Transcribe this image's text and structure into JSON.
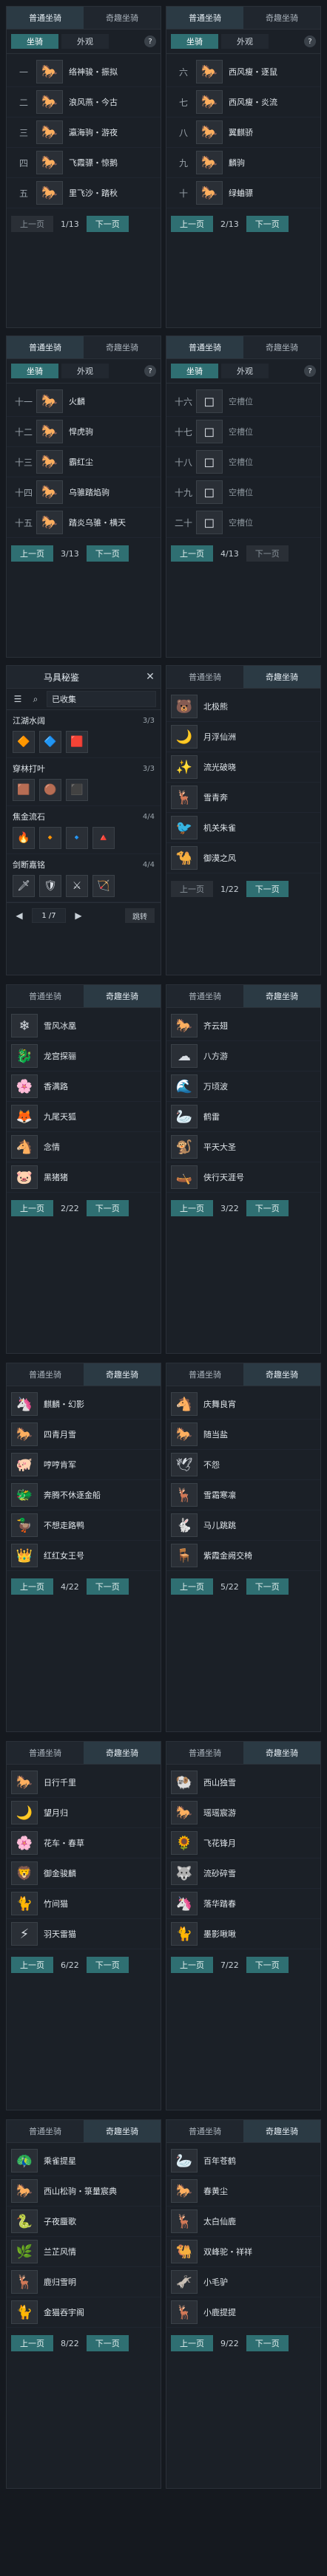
{
  "labels": {
    "cat_normal": "普通坐骑",
    "cat_rare": "奇趣坐骑",
    "sub_mount": "坐骑",
    "sub_look": "外观",
    "help": "?",
    "prev": "上一页",
    "next": "下一页"
  },
  "icons": {
    "mount": "horse-icon",
    "empty": "empty-slot-icon",
    "close": "close-icon",
    "filter": "filter-icon",
    "search": "search-icon",
    "arrow_left": "arrow-left-icon",
    "arrow_right": "arrow-right-icon"
  },
  "left_panels": [
    {
      "page": "1/13",
      "rows": [
        {
          "idx": "一",
          "name": "络神骏・振拟"
        },
        {
          "idx": "二",
          "name": "浪风燕・今古"
        },
        {
          "idx": "三",
          "name": "瀛海驹・游夜"
        },
        {
          "idx": "四",
          "name": "飞霞骠・惊鹅"
        },
        {
          "idx": "五",
          "name": "里飞沙・踏秋"
        }
      ]
    },
    {
      "page": "3/13",
      "rows": [
        {
          "idx": "十一",
          "name": "火麟"
        },
        {
          "idx": "十二",
          "name": "悍虎驹"
        },
        {
          "idx": "十三",
          "name": "霸红尘"
        },
        {
          "idx": "十四",
          "name": "乌骓踏焰驹"
        },
        {
          "idx": "十五",
          "name": "踏炎乌骓・横天"
        }
      ]
    }
  ],
  "right_panels": [
    {
      "page": "2/13",
      "rows": [
        {
          "idx": "六",
          "name": "西风瘦・逐鼠"
        },
        {
          "idx": "七",
          "name": "西风瘦・炎流"
        },
        {
          "idx": "八",
          "name": "翼麒骄"
        },
        {
          "idx": "九",
          "name": "麟驹"
        },
        {
          "idx": "十",
          "name": "绿蛐骠"
        }
      ]
    },
    {
      "page": "4/13",
      "rows": [
        {
          "idx": "十六",
          "name": "空槽位"
        },
        {
          "idx": "十七",
          "name": "空槽位"
        },
        {
          "idx": "十八",
          "name": "空槽位"
        },
        {
          "idx": "十九",
          "name": "空槽位"
        },
        {
          "idx": "二十",
          "name": "空槽位"
        }
      ]
    }
  ],
  "equip_panel": {
    "title": "马具秘鉴",
    "select": "已收集",
    "sets": [
      {
        "name": "江湖水阔",
        "count": "3/3"
      },
      {
        "name": "穿林打叶",
        "count": "3/3"
      },
      {
        "name": "焦金流石",
        "count": "4/4"
      },
      {
        "name": "剑断嘉铭",
        "count": "4/4"
      }
    ],
    "page": "1 /7",
    "jump": "跳转"
  },
  "rare_right_1": {
    "page": "1/22",
    "rows": [
      {
        "name": "北极熊"
      },
      {
        "name": "月浮仙洲"
      },
      {
        "name": "流光破晓"
      },
      {
        "name": "雪青奔"
      },
      {
        "name": "机关朱雀"
      },
      {
        "name": "御漠之风"
      }
    ]
  },
  "rare_pairs": [
    {
      "left_page": "2/22",
      "right_page": "3/22",
      "left": [
        {
          "name": "雪风冰凰"
        },
        {
          "name": "龙宫探骊"
        },
        {
          "name": "香满路"
        },
        {
          "name": "九尾天狐"
        },
        {
          "name": "念情"
        },
        {
          "name": "黑猪猪"
        }
      ],
      "right": [
        {
          "name": "齐云翅"
        },
        {
          "name": "八方游"
        },
        {
          "name": "万顷波"
        },
        {
          "name": "鹤雷"
        },
        {
          "name": "平天大圣"
        },
        {
          "name": "侠行天涯号"
        }
      ]
    },
    {
      "left_page": "4/22",
      "right_page": "5/22",
      "left": [
        {
          "name": "麒麟・幻影"
        },
        {
          "name": "四青月雪"
        },
        {
          "name": "哼哼肯军"
        },
        {
          "name": "奔腾不休逐金船"
        },
        {
          "name": "不想走路鸭"
        },
        {
          "name": "红红女王号"
        }
      ],
      "right": [
        {
          "name": "庆舞良宵"
        },
        {
          "name": "随当盐"
        },
        {
          "name": "不怨"
        },
        {
          "name": "雪霜寒凛"
        },
        {
          "name": "马儿跳跳"
        },
        {
          "name": "紫霞金阙交椅"
        }
      ]
    },
    {
      "left_page": "6/22",
      "right_page": "7/22",
      "left": [
        {
          "name": "日行千里"
        },
        {
          "name": "望月归"
        },
        {
          "name": "花车・春草"
        },
        {
          "name": "御金骏麟"
        },
        {
          "name": "竹间猫"
        },
        {
          "name": "羽天雷猫"
        }
      ],
      "right": [
        {
          "name": "西山独雪"
        },
        {
          "name": "瑶瑶宸游"
        },
        {
          "name": "飞花锋月"
        },
        {
          "name": "流砂碎雪"
        },
        {
          "name": "落华踏春"
        },
        {
          "name": "墨影啾啾"
        }
      ]
    },
    {
      "left_page": "8/22",
      "right_page": "9/22",
      "left": [
        {
          "name": "乘雀提星"
        },
        {
          "name": "西山松驹・箓量宸典"
        },
        {
          "name": "子夜蜃歌"
        },
        {
          "name": "兰芷风情"
        },
        {
          "name": "鹿归雪明"
        },
        {
          "name": "金猫吞宇阁"
        }
      ],
      "right": [
        {
          "name": "百年苍鹤"
        },
        {
          "name": "春黄尘"
        },
        {
          "name": "太白仙鹿"
        },
        {
          "name": "双峰驼・祥祥"
        },
        {
          "name": "小毛驴"
        },
        {
          "name": "小鹿提提"
        }
      ]
    }
  ]
}
